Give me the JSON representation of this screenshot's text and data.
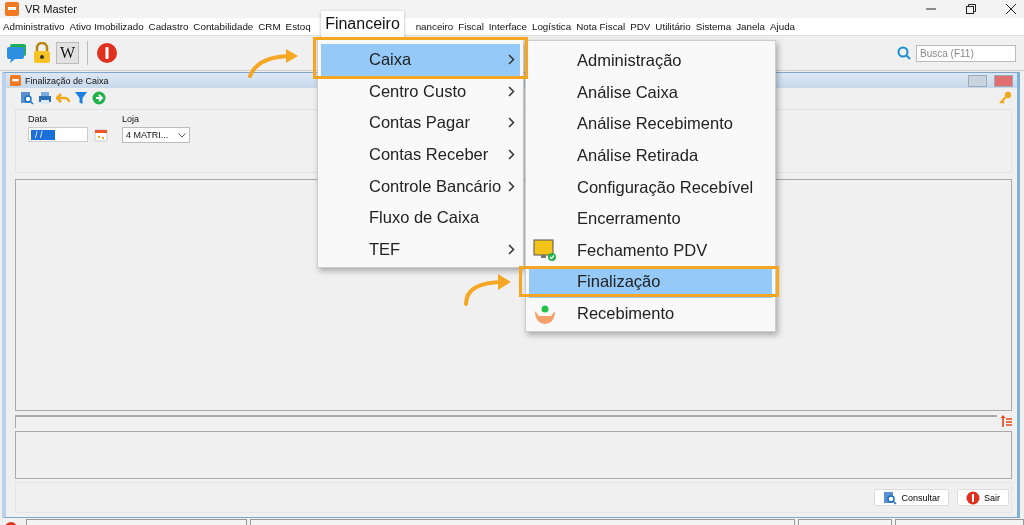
{
  "window": {
    "title": "VR Master"
  },
  "menu_bar": [
    {
      "label": "Administrativo"
    },
    {
      "label": "Ativo Imobilizado"
    },
    {
      "label": "Cadastro"
    },
    {
      "label": "Contabilidade"
    },
    {
      "label": "CRM"
    },
    {
      "label": "Estoq"
    },
    {
      "label": "nanceiro"
    },
    {
      "label": "Fiscal"
    },
    {
      "label": "Interface"
    },
    {
      "label": "Logística"
    },
    {
      "label": "Nota Fiscal"
    },
    {
      "label": "PDV"
    },
    {
      "label": "Utilitário"
    },
    {
      "label": "Sistema"
    },
    {
      "label": "Janela"
    },
    {
      "label": "Ajuda"
    }
  ],
  "toolbar": {
    "w_button": "W"
  },
  "search": {
    "placeholder": "Busca (F11)"
  },
  "callout": {
    "label": "Financeiro"
  },
  "financeiro_menu": [
    {
      "label": "Caixa",
      "submenu": true,
      "selected": true
    },
    {
      "label": "Centro Custo",
      "submenu": true,
      "selected": false
    },
    {
      "label": "Contas Pagar",
      "submenu": true,
      "selected": false
    },
    {
      "label": "Contas Receber",
      "submenu": true,
      "selected": false
    },
    {
      "label": "Controle Bancário",
      "submenu": true,
      "selected": false
    },
    {
      "label": "Fluxo de Caixa",
      "submenu": false,
      "selected": false
    },
    {
      "label": "TEF",
      "submenu": true,
      "selected": false
    }
  ],
  "caixa_submenu": [
    {
      "label": "Administração",
      "kind": "plain",
      "selected": false
    },
    {
      "label": "Análise Caixa",
      "kind": "plain",
      "selected": false
    },
    {
      "label": "Análise Recebimento",
      "kind": "plain",
      "selected": false
    },
    {
      "label": "Análise Retirada",
      "kind": "plain",
      "selected": false
    },
    {
      "label": "Configuração Recebível",
      "kind": "plain",
      "selected": false
    },
    {
      "label": "Encerramento",
      "kind": "plain",
      "selected": false
    },
    {
      "label": "Fechamento PDV",
      "kind": "monitor",
      "selected": false
    },
    {
      "label": "Finalização",
      "kind": "plain",
      "selected": true
    },
    {
      "label": "Recebimento",
      "kind": "hands",
      "selected": false
    }
  ],
  "inner_window": {
    "title": "Finalização de Caixa"
  },
  "filters": {
    "data": {
      "label": "Data",
      "value": "/ /"
    },
    "loja": {
      "label": "Loja",
      "value": "4 MATRI..."
    }
  },
  "buttons": [
    {
      "label": "Consultar",
      "kind": "search"
    },
    {
      "label": "Sair",
      "kind": "exit"
    }
  ]
}
